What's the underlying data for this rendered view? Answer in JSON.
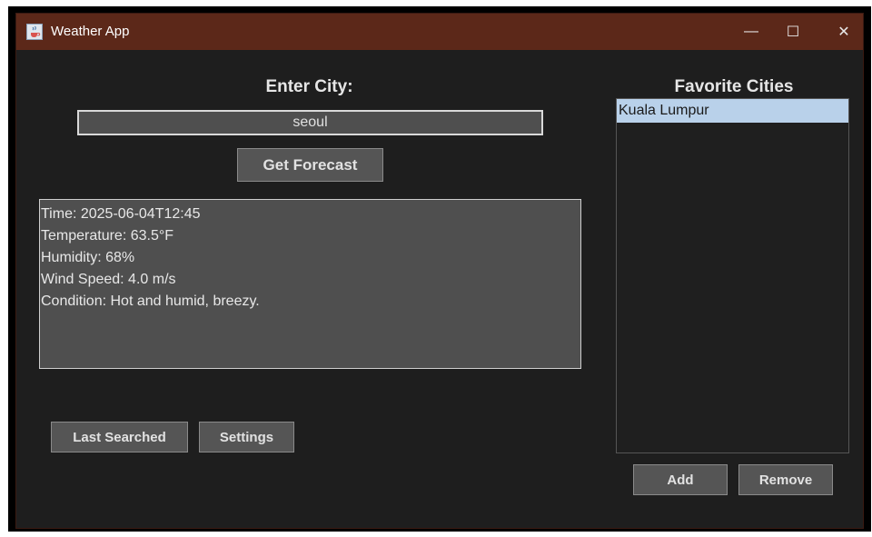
{
  "window": {
    "title": "Weather App",
    "icon": "java-cup-icon",
    "controls": {
      "minimize": "—",
      "maximize": "☐",
      "close": "✕"
    }
  },
  "search": {
    "label": "Enter City:",
    "value": "seoul",
    "button_label": "Get Forecast"
  },
  "forecast": {
    "lines": [
      "Time: 2025-06-04T12:45",
      "Temperature: 63.5°F",
      "Humidity: 68%",
      "Wind Speed: 4.0 m/s",
      "Condition: Hot and humid, breezy."
    ]
  },
  "actions": {
    "last_searched_label": "Last Searched",
    "settings_label": "Settings"
  },
  "favorites": {
    "title": "Favorite Cities",
    "items": [
      "Kuala Lumpur"
    ],
    "selected_index": 0,
    "add_label": "Add",
    "remove_label": "Remove"
  },
  "colors": {
    "titlebar": "#5c2819",
    "background": "#1e1e1e",
    "field": "#4f4f4f",
    "button": "#555555",
    "selection": "#b9d1ea"
  }
}
